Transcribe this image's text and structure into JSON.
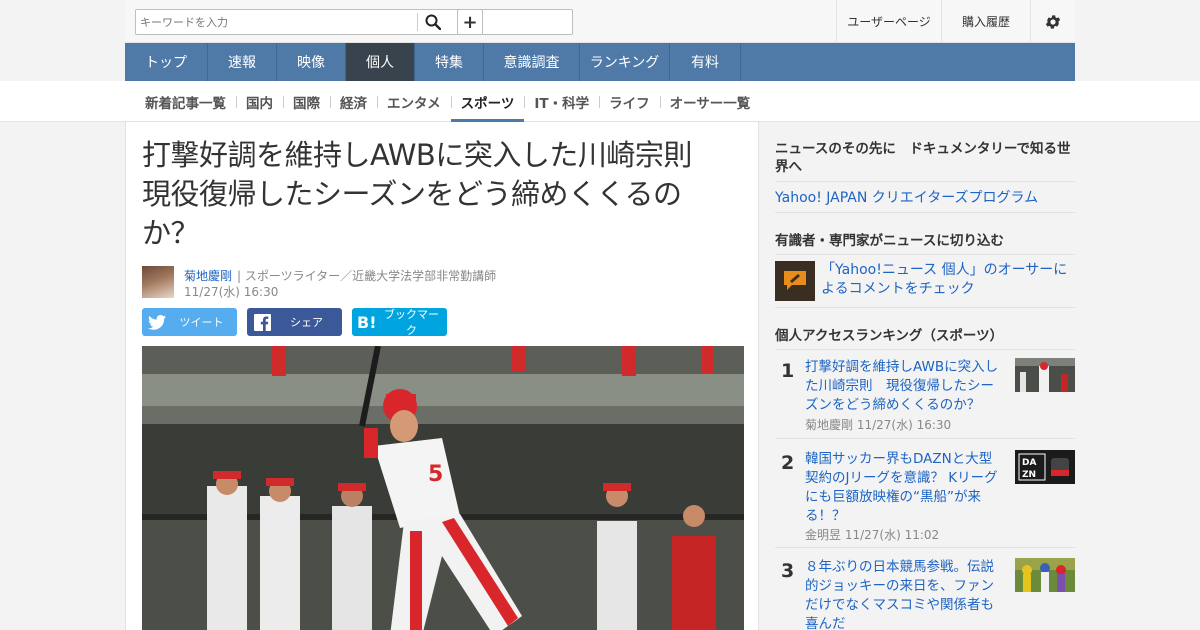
{
  "search": {
    "placeholder": "キーワードを入力"
  },
  "toolbar": {
    "search_icon": "search-icon",
    "plus_label": "+",
    "user_page": "ユーザーページ",
    "purchase_history": "購入履歴",
    "settings_icon": "gear-icon"
  },
  "main_nav": [
    "トップ",
    "速報",
    "映像",
    "個人",
    "特集",
    "意識調査",
    "ランキング",
    "有料"
  ],
  "main_nav_active": "個人",
  "sub_nav": [
    "新着記事一覧",
    "国内",
    "国際",
    "経済",
    "エンタメ",
    "スポーツ",
    "IT・科学",
    "ライフ",
    "オーサー一覧"
  ],
  "sub_nav_active": "スポーツ",
  "article": {
    "title": "打撃好調を維持しAWBに突入した川崎宗則　現役復帰したシーズンをどう締めくくるのか？",
    "author": "菊地慶剛",
    "author_desc": "| スポーツライター／近畿大学法学部非常勤講師",
    "date": "11/27(水) 16:30",
    "share": {
      "twitter": "ツイート",
      "facebook": "シェア",
      "hatena": "ブックマーク"
    }
  },
  "sidebar": {
    "doc_heading": "ニュースのその先に　ドキュメンタリーで知る世界へ",
    "creators_link": "Yahoo! JAPAN クリエイターズプログラム",
    "expert_heading": "有識者・専門家がニュースに切り込む",
    "expert_link": "「Yahoo!ニュース 個人」のオーサーによるコメントをチェック",
    "ranking_heading": "個人アクセスランキング（スポーツ）",
    "ranking": [
      {
        "rank": "1",
        "title": "打撃好調を維持しAWBに突入した川崎宗則　現役復帰したシーズンをどう締めくくるのか？",
        "author": "菊地慶剛",
        "date": "11/27(水) 16:30"
      },
      {
        "rank": "2",
        "title": "韓国サッカー界もDAZNと大型契約のJリーグを意識？ Kリーグにも巨額放映権の“黒船”が来る！？",
        "author": "金明昱",
        "date": "11/27(水) 11:02"
      },
      {
        "rank": "3",
        "title": "８年ぶりの日本競馬参戦。伝説的ジョッキーの来日を、ファンだけでなくマスコミや関係者も喜んだ",
        "author": "",
        "date": ""
      }
    ]
  },
  "colors": {
    "nav_blue": "#4f7aa8",
    "nav_active": "#38434d",
    "link_blue": "#1d64c3",
    "twitter": "#55acee",
    "facebook": "#3b5998",
    "hatena": "#00a4de"
  }
}
